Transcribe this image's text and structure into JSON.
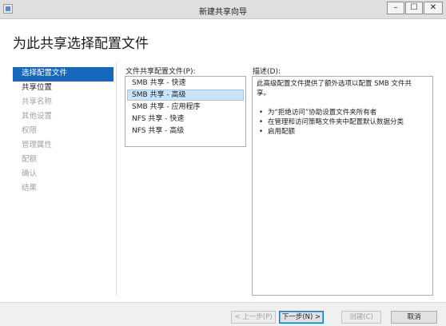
{
  "window": {
    "title": "新建共享向导",
    "min_glyph": "–",
    "max_glyph": "☐",
    "close_glyph": "✕"
  },
  "page": {
    "title": "为此共享选择配置文件"
  },
  "sidebar": {
    "items": [
      {
        "label": "选择配置文件",
        "state": "selected"
      },
      {
        "label": "共享位置",
        "state": "enabled"
      },
      {
        "label": "共享名称",
        "state": "disabled"
      },
      {
        "label": "其他设置",
        "state": "disabled"
      },
      {
        "label": "权限",
        "state": "disabled"
      },
      {
        "label": "管理属性",
        "state": "disabled"
      },
      {
        "label": "配额",
        "state": "disabled"
      },
      {
        "label": "确认",
        "state": "disabled"
      },
      {
        "label": "结果",
        "state": "disabled"
      }
    ]
  },
  "profiles": {
    "label": "文件共享配置文件(P):",
    "items": [
      {
        "label": "SMB 共享 - 快速",
        "selected": false
      },
      {
        "label": "SMB 共享 - 高级",
        "selected": true
      },
      {
        "label": "SMB 共享 - 应用程序",
        "selected": false
      },
      {
        "label": "NFS 共享 - 快速",
        "selected": false
      },
      {
        "label": "NFS 共享 - 高级",
        "selected": false
      }
    ]
  },
  "description": {
    "label": "描述(D):",
    "intro_line1": "此高级配置文件提供了额外选项以配置 SMB 文件共",
    "intro_line2": "享。",
    "bullets": [
      "为“拒绝访问”协助设置文件夹所有者",
      "在管理和访问策略文件夹中配置默认数据分类",
      "启用配额"
    ],
    "bullet_glyph": "•"
  },
  "buttons": {
    "prev": "< 上一步(P)",
    "next": "下一步(N) >",
    "create": "创建(C)",
    "cancel": "取消"
  },
  "colors": {
    "selected_nav": "#1668bd",
    "selected_list": "#cce4f7",
    "disabled_text": "#a3a3a3"
  }
}
